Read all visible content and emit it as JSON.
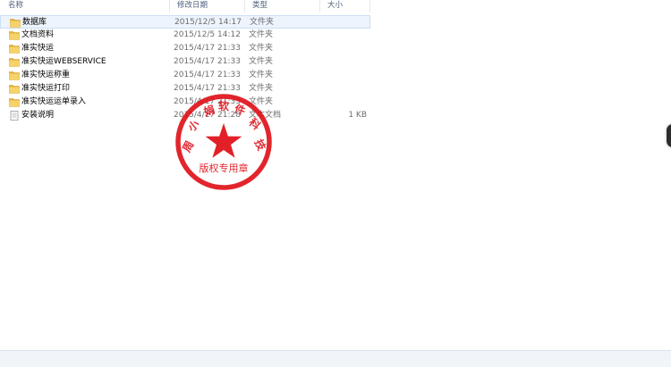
{
  "columns": {
    "name": "名称",
    "date": "修改日期",
    "type": "类型",
    "size": "大小"
  },
  "files": [
    {
      "name": "数据库",
      "date": "2015/12/5 14:17",
      "type": "文件夹",
      "size": "",
      "icon": "folder-icon",
      "selected": true
    },
    {
      "name": "文档资料",
      "date": "2015/12/5 14:12",
      "type": "文件夹",
      "size": "",
      "icon": "folder-icon",
      "selected": false
    },
    {
      "name": "准实快运",
      "date": "2015/4/17 21:33",
      "type": "文件夹",
      "size": "",
      "icon": "folder-icon",
      "selected": false
    },
    {
      "name": "准实快运WEBSERVICE",
      "date": "2015/4/17 21:33",
      "type": "文件夹",
      "size": "",
      "icon": "folder-icon",
      "selected": false
    },
    {
      "name": "准实快运称重",
      "date": "2015/4/17 21:33",
      "type": "文件夹",
      "size": "",
      "icon": "folder-icon",
      "selected": false
    },
    {
      "name": "准实快运打印",
      "date": "2015/4/17 21:33",
      "type": "文件夹",
      "size": "",
      "icon": "folder-icon",
      "selected": false
    },
    {
      "name": "准实快运运单录入",
      "date": "2015/4/17 21:33",
      "type": "文件夹",
      "size": "",
      "icon": "folder-icon",
      "selected": false
    },
    {
      "name": "安装说明",
      "date": "2015/4/17 21:28",
      "type": "文本文档",
      "size": "1 KB",
      "icon": "text-document-icon",
      "selected": false
    }
  ],
  "seal": {
    "top_text": "周 小 娟 软 件 科 技",
    "bottom_text": "版权专用章",
    "color": "#e0141c"
  },
  "colors": {
    "folder": "#e8b53c",
    "selection": "#edf4fc",
    "header_text": "#4c607a"
  }
}
